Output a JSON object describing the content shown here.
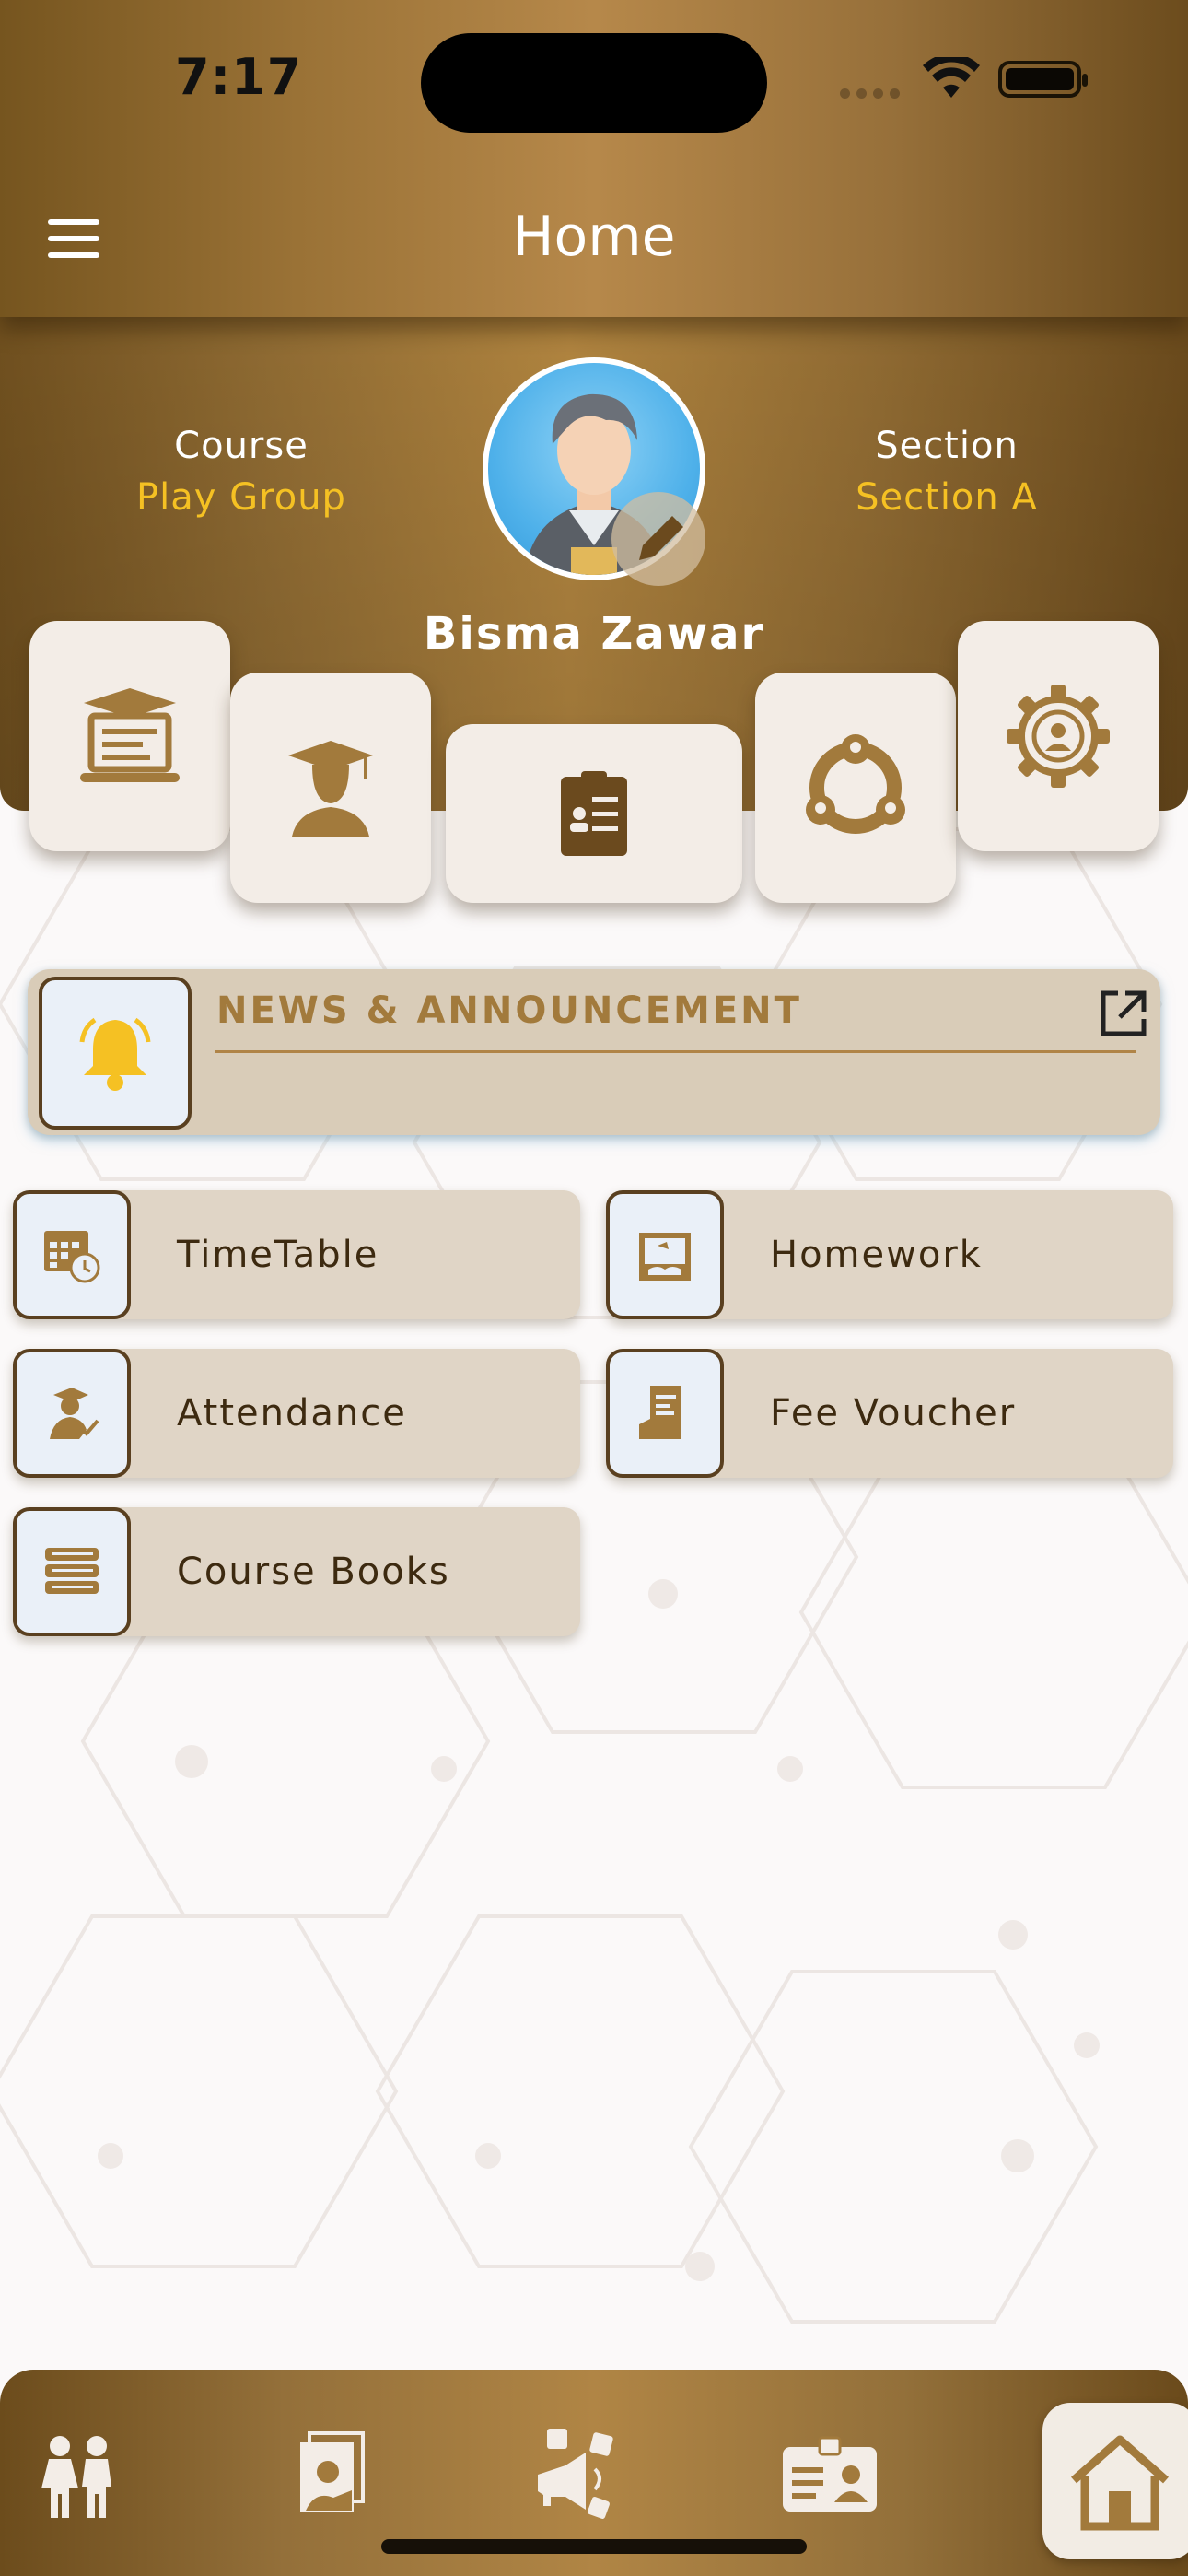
{
  "status_bar": {
    "time": "7:17"
  },
  "app_bar": {
    "title": "Home",
    "menu_icon": "hamburger-menu-icon"
  },
  "profile": {
    "course_label": "Course",
    "course_value": "Play Group",
    "section_label": "Section",
    "section_value": "Section A",
    "name": "Bisma Zawar"
  },
  "quick_actions": [
    {
      "icon": "online-class-icon"
    },
    {
      "icon": "graduate-icon"
    },
    {
      "icon": "clipboard-report-icon"
    },
    {
      "icon": "team-network-icon"
    },
    {
      "icon": "user-settings-icon"
    }
  ],
  "news": {
    "title": "NEWS & ANNOUNCEMENT",
    "icon": "bell-icon",
    "action_icon": "open-external-icon"
  },
  "menu": [
    {
      "label": "TimeTable",
      "icon": "calendar-clock-icon"
    },
    {
      "label": "Homework",
      "icon": "homework-desk-icon"
    },
    {
      "label": "Attendance",
      "icon": "teacher-check-icon"
    },
    {
      "label": "Fee Voucher",
      "icon": "fee-voucher-icon"
    },
    {
      "label": "Course Books",
      "icon": "books-stack-icon"
    }
  ],
  "bottom_nav": [
    {
      "icon": "children-icon"
    },
    {
      "icon": "gallery-icon"
    },
    {
      "icon": "social-media-icon"
    },
    {
      "icon": "id-card-icon"
    },
    {
      "icon": "home-icon",
      "active": true
    }
  ],
  "colors": {
    "accent_gold": "#f5c123",
    "brand_brown": "#a27a3c",
    "card_bg": "#e0d5c6"
  }
}
